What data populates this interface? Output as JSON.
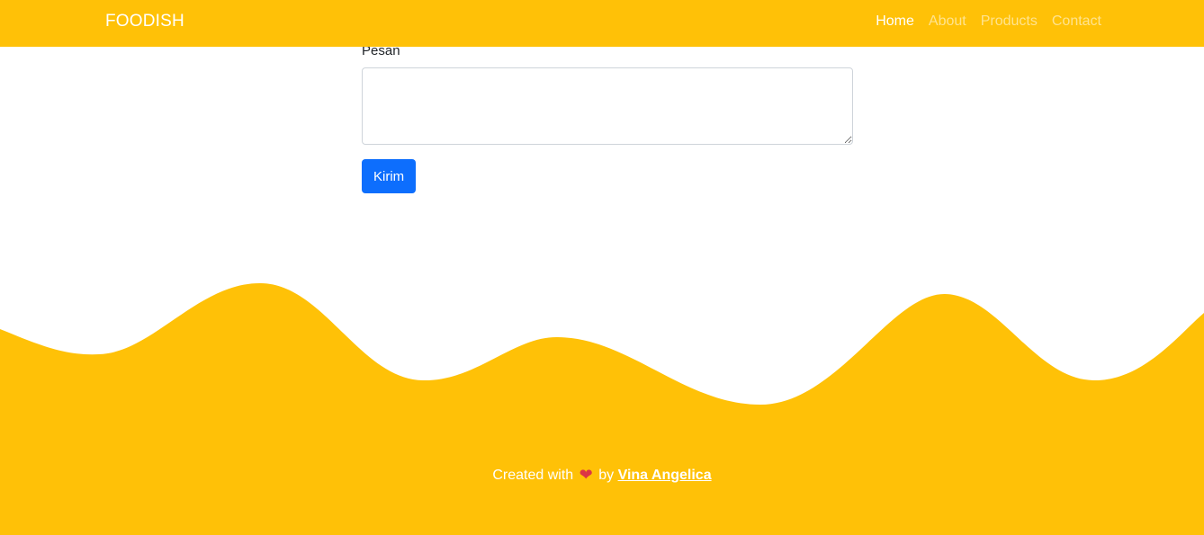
{
  "navbar": {
    "brand": "FOODISH",
    "links": [
      {
        "label": "Home",
        "active": true
      },
      {
        "label": "About",
        "active": false
      },
      {
        "label": "Products",
        "active": false
      },
      {
        "label": "Contact",
        "active": false
      }
    ]
  },
  "form": {
    "message_label": "Pesan",
    "message_value": "",
    "submit_label": "Kirim"
  },
  "footer": {
    "prefix": "Created with",
    "heart_icon": "heart-icon",
    "by": "by",
    "author": "Vina Angelica"
  },
  "colors": {
    "primary": "#ffc107",
    "button": "#0d6efd",
    "heart": "#dc3545"
  }
}
